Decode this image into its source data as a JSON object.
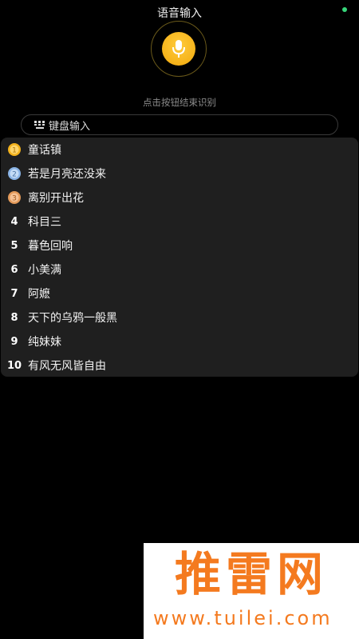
{
  "header": {
    "title": "语音输入"
  },
  "voice": {
    "hint": "点击按钮结束识别"
  },
  "keyboard": {
    "label": "键盘输入"
  },
  "suggestions": [
    {
      "rank": "1",
      "text": "童话镇",
      "medal": "gold"
    },
    {
      "rank": "2",
      "text": "若是月亮还没来",
      "medal": "silver"
    },
    {
      "rank": "3",
      "text": "离别开出花",
      "medal": "bronze"
    },
    {
      "rank": "4",
      "text": "科目三"
    },
    {
      "rank": "5",
      "text": "暮色回响"
    },
    {
      "rank": "6",
      "text": "小美满"
    },
    {
      "rank": "7",
      "text": "阿嬷"
    },
    {
      "rank": "8",
      "text": "天下的乌鸦一般黑"
    },
    {
      "rank": "9",
      "text": "纯妹妹"
    },
    {
      "rank": "10",
      "text": "有风无风皆自由"
    }
  ],
  "watermark": {
    "brand": "推雷网",
    "url": "www.tuilei.com"
  },
  "colors": {
    "background": "#000000",
    "mic_button": "#f2a90b",
    "status_dot": "#37d67a",
    "panel": "#1f1f1f",
    "watermark": "#f47a1f",
    "medal_gold": "#f3b21c",
    "medal_silver": "#8ab4e6",
    "medal_bronze": "#e39a5a"
  }
}
